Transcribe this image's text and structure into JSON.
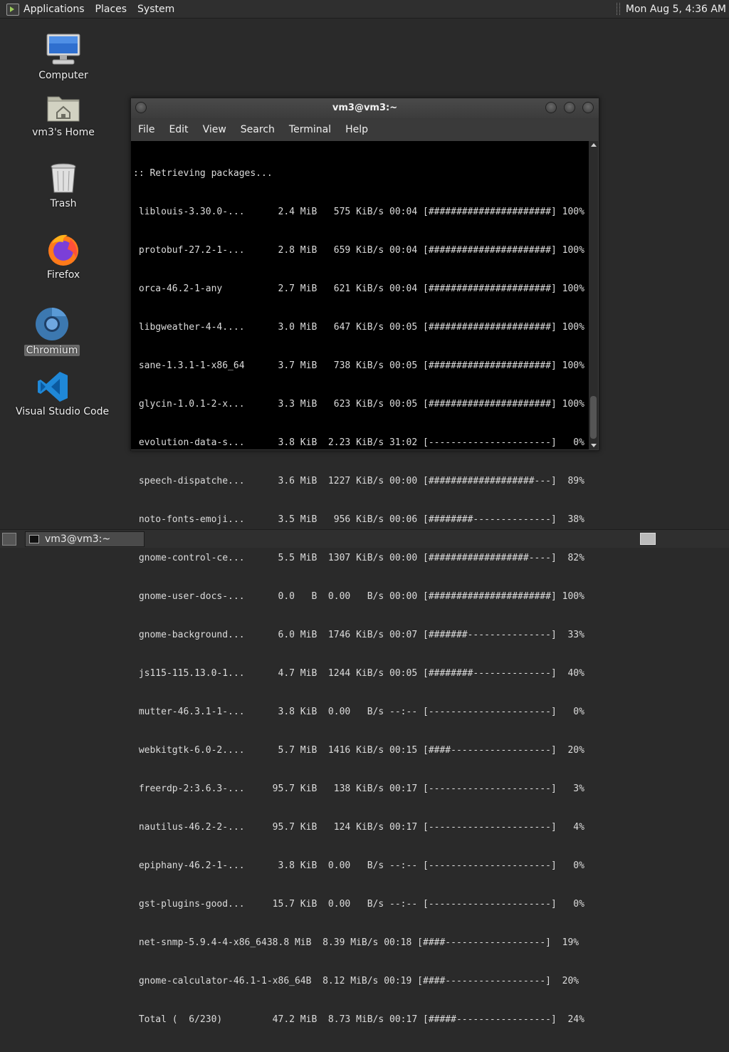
{
  "top_panel": {
    "menus": [
      "Applications",
      "Places",
      "System"
    ],
    "clock": "Mon Aug  5,  4:36 AM"
  },
  "desktop": {
    "icons": [
      {
        "label": "Computer",
        "icon": "computer-icon"
      },
      {
        "label": "vm3's Home",
        "icon": "home-folder-icon"
      },
      {
        "label": "Trash",
        "icon": "trash-icon"
      },
      {
        "label": "Firefox",
        "icon": "firefox-icon"
      },
      {
        "label": "Chromium",
        "icon": "chromium-icon",
        "selected": true
      },
      {
        "label": "Visual Studio Code",
        "icon": "vscode-icon"
      }
    ]
  },
  "terminal": {
    "title": "vm3@vm3:~",
    "menus": [
      "File",
      "Edit",
      "View",
      "Search",
      "Terminal",
      "Help"
    ],
    "lines": [
      ":: Retrieving packages...",
      " liblouis-3.30.0-...      2.4 MiB   575 KiB/s 00:04 [######################] 100%",
      " protobuf-27.2-1-...      2.8 MiB   659 KiB/s 00:04 [######################] 100%",
      " orca-46.2-1-any          2.7 MiB   621 KiB/s 00:04 [######################] 100%",
      " libgweather-4-4....      3.0 MiB   647 KiB/s 00:05 [######################] 100%",
      " sane-1.3.1-1-x86_64      3.7 MiB   738 KiB/s 00:05 [######################] 100%",
      " glycin-1.0.1-2-x...      3.3 MiB   623 KiB/s 00:05 [######################] 100%",
      " evolution-data-s...      3.8 KiB  2.23 KiB/s 31:02 [----------------------]   0%",
      " speech-dispatche...      3.6 MiB  1227 KiB/s 00:00 [###################---]  89%",
      " noto-fonts-emoji...      3.5 MiB   956 KiB/s 00:06 [########--------------]  38%",
      " gnome-control-ce...      5.5 MiB  1307 KiB/s 00:00 [##################----]  82%",
      " gnome-user-docs-...      0.0   B  0.00   B/s 00:00 [######################] 100%",
      " gnome-background...      6.0 MiB  1746 KiB/s 00:07 [#######---------------]  33%",
      " js115-115.13.0-1...      4.7 MiB  1244 KiB/s 00:05 [########--------------]  40%",
      " mutter-46.3.1-1-...      3.8 KiB  0.00   B/s --:-- [----------------------]   0%",
      " webkitgtk-6.0-2....      5.7 MiB  1416 KiB/s 00:15 [####------------------]  20%",
      " freerdp-2:3.6.3-...     95.7 KiB   138 KiB/s 00:17 [----------------------]   3%",
      " nautilus-46.2-2-...     95.7 KiB   124 KiB/s 00:17 [----------------------]   4%",
      " epiphany-46.2-1-...      3.8 KiB  0.00   B/s --:-- [----------------------]   0%",
      " gst-plugins-good...     15.7 KiB  0.00   B/s --:-- [----------------------]   0%",
      " net-snmp-5.9.4-4-x86_6438.8 MiB  8.39 MiB/s 00:18 [####------------------]  19%",
      " gnome-calculator-46.1-1-x86_64B  8.12 MiB/s 00:19 [####------------------]  20%",
      " Total (  6/230)         47.2 MiB  8.73 MiB/s 00:17 [#####-----------------]  24%"
    ]
  },
  "bottom_panel": {
    "task_label": "vm3@vm3:~"
  }
}
